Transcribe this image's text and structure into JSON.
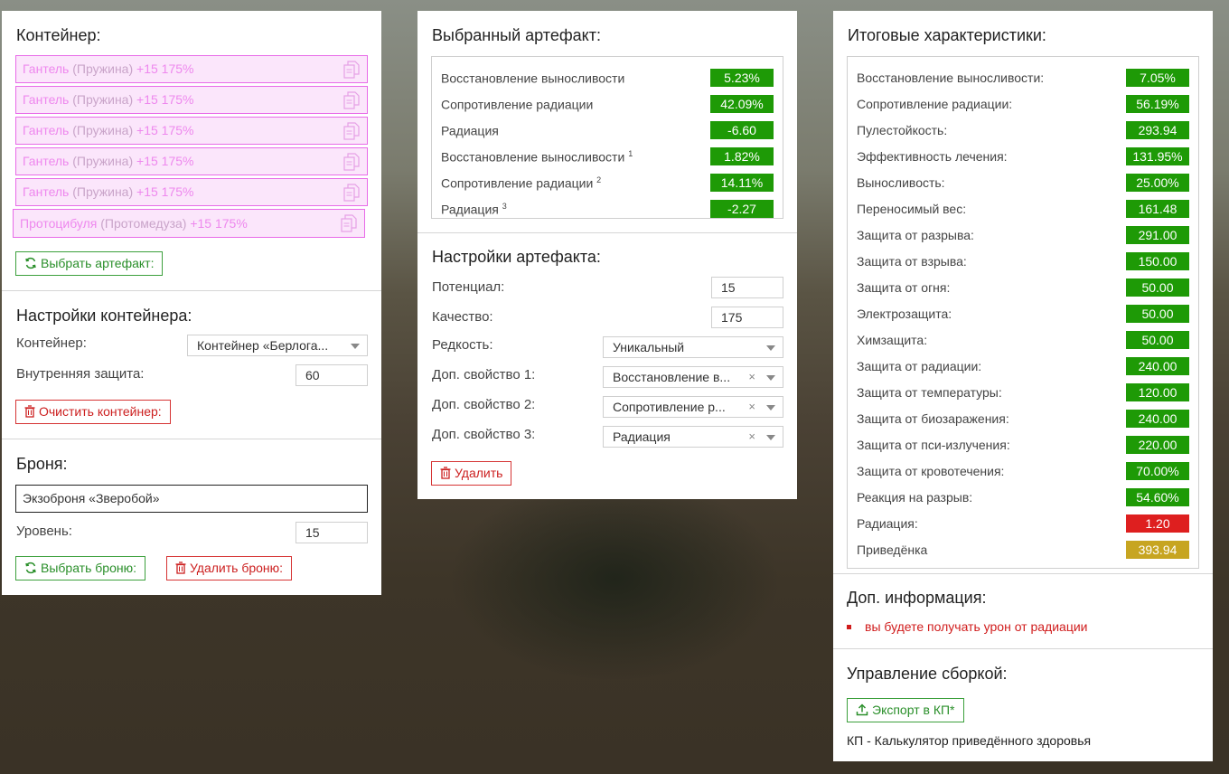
{
  "container_panel": {
    "title": "Контейнер:",
    "artifacts": [
      {
        "name": "Гантель",
        "sub": "(Пружина)",
        "level": "+15 175%"
      },
      {
        "name": "Гантель",
        "sub": "(Пружина)",
        "level": "+15 175%"
      },
      {
        "name": "Гантель",
        "sub": "(Пружина)",
        "level": "+15 175%"
      },
      {
        "name": "Гантель",
        "sub": "(Пружина)",
        "level": "+15 175%"
      },
      {
        "name": "Гантель",
        "sub": "(Пружина)",
        "level": "+15 175%"
      },
      {
        "name": "Протоцибуля",
        "sub": "(Протомедуза)",
        "level": "+15 175%"
      }
    ],
    "select_artifact_button": "Выбрать артефакт:",
    "settings_title": "Настройки контейнера:",
    "container_label": "Контейнер:",
    "container_value": "Контейнер «Берлога...",
    "inner_protection_label": "Внутренняя защита:",
    "inner_protection_value": "60",
    "clear_button": "Очистить контейнер:",
    "armor_title": "Броня:",
    "armor_value": "Экзоброня «Зверобой»",
    "level_label": "Уровень:",
    "level_value": "15",
    "select_armor_button": "Выбрать броню:",
    "delete_armor_button": "Удалить броню:"
  },
  "artifact_panel": {
    "title": "Выбранный артефакт:",
    "stats": [
      {
        "name": "Восстановление выносливости",
        "sup": "",
        "value": "5.23%"
      },
      {
        "name": "Сопротивление радиации",
        "sup": "",
        "value": "42.09%"
      },
      {
        "name": "Радиация",
        "sup": "",
        "value": "-6.60"
      },
      {
        "name": "Восстановление выносливости",
        "sup": "1",
        "value": "1.82%"
      },
      {
        "name": "Сопротивление радиации",
        "sup": "2",
        "value": "14.11%"
      },
      {
        "name": "Радиация",
        "sup": "3",
        "value": "-2.27"
      }
    ],
    "settings_title": "Настройки артефакта:",
    "potential_label": "Потенциал:",
    "potential_value": "15",
    "quality_label": "Качество:",
    "quality_value": "175",
    "rarity_label": "Редкость:",
    "rarity_value": "Уникальный",
    "extra1_label": "Доп. свойство 1:",
    "extra1_value": "Восстановление в...",
    "extra2_label": "Доп. свойство 2:",
    "extra2_value": "Сопротивление р...",
    "extra3_label": "Доп. свойство 3:",
    "extra3_value": "Радиация",
    "clear_x": "×",
    "delete_button": "Удалить"
  },
  "totals_panel": {
    "title": "Итоговые характеристики:",
    "stats": [
      {
        "name": "Восстановление выносливости:",
        "value": "7.05%",
        "color": "green"
      },
      {
        "name": "Сопротивление радиации:",
        "value": "56.19%",
        "color": "green"
      },
      {
        "name": "Пулестойкость:",
        "value": "293.94",
        "color": "green"
      },
      {
        "name": "Эффективность лечения:",
        "value": "131.95%",
        "color": "green"
      },
      {
        "name": "Выносливость:",
        "value": "25.00%",
        "color": "green"
      },
      {
        "name": "Переносимый вес:",
        "value": "161.48",
        "color": "green"
      },
      {
        "name": "Защита от разрыва:",
        "value": "291.00",
        "color": "green"
      },
      {
        "name": "Защита от взрыва:",
        "value": "150.00",
        "color": "green"
      },
      {
        "name": "Защита от огня:",
        "value": "50.00",
        "color": "green"
      },
      {
        "name": "Электрозащита:",
        "value": "50.00",
        "color": "green"
      },
      {
        "name": "Химзащита:",
        "value": "50.00",
        "color": "green"
      },
      {
        "name": "Защита от радиации:",
        "value": "240.00",
        "color": "green"
      },
      {
        "name": "Защита от температуры:",
        "value": "120.00",
        "color": "green"
      },
      {
        "name": "Защита от биозаражения:",
        "value": "240.00",
        "color": "green"
      },
      {
        "name": "Защита от пси-излучения:",
        "value": "220.00",
        "color": "green"
      },
      {
        "name": "Защита от кровотечения:",
        "value": "70.00%",
        "color": "green"
      },
      {
        "name": "Реакция на разрыв:",
        "value": "54.60%",
        "color": "green"
      },
      {
        "name": "Радиация:",
        "value": "1.20",
        "color": "red"
      },
      {
        "name": "Приведёнка",
        "value": "393.94",
        "color": "gold"
      }
    ],
    "info_title": "Доп. информация:",
    "info_item": "вы будете получать урон от радиации",
    "manage_title": "Управление сборкой:",
    "export_button": "Экспорт в КП*",
    "footnote": "КП - Калькулятор приведённого здоровья"
  }
}
